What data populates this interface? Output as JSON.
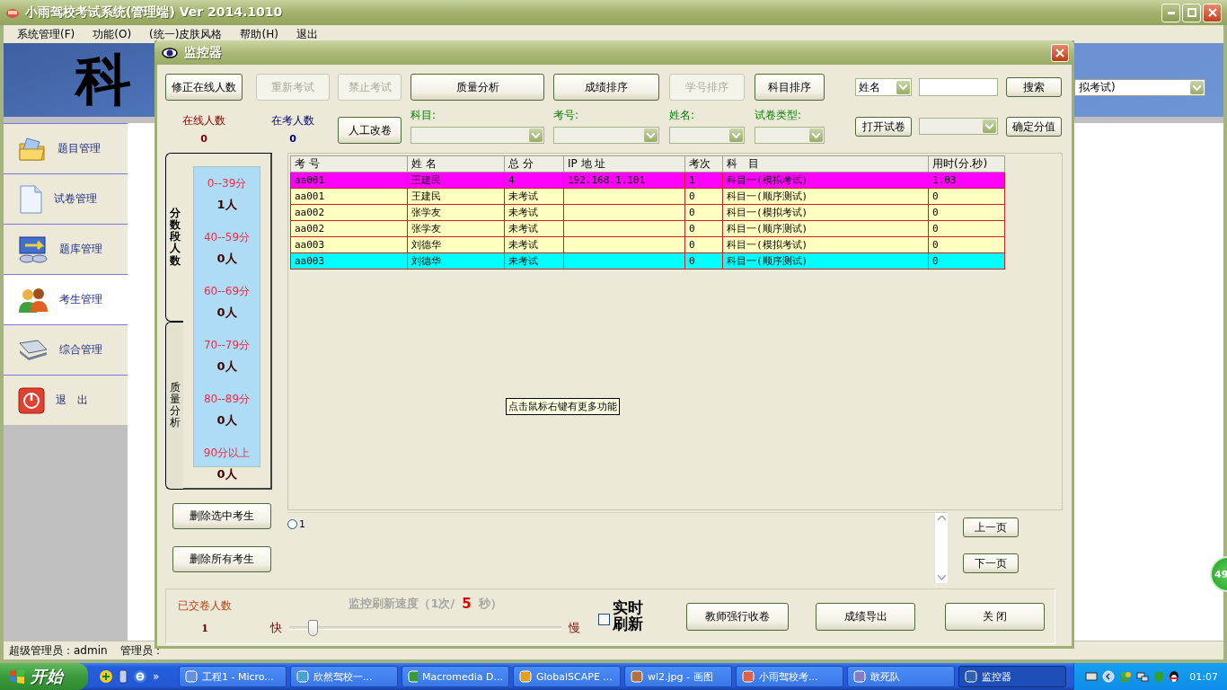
{
  "main_window": {
    "title": "小雨驾校考试系统(管理端) Ver 2014.1010",
    "menu": [
      "系统管理(F)",
      "功能(O)",
      "(统一)皮肤风格",
      "帮助(H)",
      "退出"
    ],
    "banner_text": "科",
    "banner_dropdown": "拟考试)",
    "sidebar": [
      {
        "label": "题目管理",
        "kind": "folder",
        "selected": false
      },
      {
        "label": "试卷管理",
        "kind": "document",
        "selected": false
      },
      {
        "label": "题库管理",
        "kind": "database",
        "selected": false
      },
      {
        "label": "考生管理",
        "kind": "users",
        "selected": true
      },
      {
        "label": "综合管理",
        "kind": "scanner",
        "selected": false
      },
      {
        "label": "退　出",
        "kind": "power",
        "selected": false
      }
    ],
    "status_bar": [
      "超级管理员：admin",
      "管理员："
    ]
  },
  "side_badge": "49",
  "dialog": {
    "title": "监控器",
    "toolbar": [
      {
        "label": "修正在线人数",
        "disabled": false
      },
      {
        "label": "重新考试",
        "disabled": true
      },
      {
        "label": "禁止考试",
        "disabled": true
      },
      {
        "label": "质量分析",
        "disabled": false
      },
      {
        "label": "成绩排序",
        "disabled": false
      },
      {
        "label": "学号排序",
        "disabled": true
      },
      {
        "label": "科目排序",
        "disabled": false
      }
    ],
    "search_field_select": "姓名",
    "search_button": "搜索",
    "counters": [
      {
        "label": "在线人数",
        "value": "0",
        "kind": "online"
      },
      {
        "label": "在考人数",
        "value": "0",
        "kind": "testing"
      }
    ],
    "manual_grade_button": "人工改卷",
    "filters": [
      "科目:",
      "考号:",
      "姓名:",
      "试卷类型:"
    ],
    "open_paper_button": "打开试卷",
    "confirm_score_button": "确定分值",
    "side_tabs": [
      {
        "label": "分数段人数",
        "selected": true
      },
      {
        "label": "质量分析",
        "selected": false
      }
    ],
    "score_bands": [
      {
        "range": "0--39分",
        "count": "1人"
      },
      {
        "range": "40--59分",
        "count": "0人"
      },
      {
        "range": "60--69分",
        "count": "0人"
      },
      {
        "range": "70--79分",
        "count": "0人"
      },
      {
        "range": "80--89分",
        "count": "0人"
      },
      {
        "range": "90分以上",
        "count": "0人"
      }
    ],
    "table": {
      "columns": [
        "考 号",
        "姓 名",
        "总 分",
        "IP 地 址",
        "考次",
        "科　目",
        "用时(分.秒)"
      ],
      "rows": [
        {
          "color": "#ff00ff",
          "cells": [
            "aa001",
            "王建民",
            "4",
            "192.168.1.101",
            "1",
            "科目一(模拟考试)",
            "1.03"
          ]
        },
        {
          "color": "#ffffc0",
          "cells": [
            "aa001",
            "王建民",
            "未考试",
            "",
            "0",
            "科目一(顺序测试)",
            "0"
          ]
        },
        {
          "color": "#ffffc0",
          "cells": [
            "aa002",
            "张学友",
            "未考试",
            "",
            "0",
            "科目一(模拟考试)",
            "0"
          ]
        },
        {
          "color": "#ffffc0",
          "cells": [
            "aa002",
            "张学友",
            "未考试",
            "",
            "0",
            "科目一(顺序测试)",
            "0"
          ]
        },
        {
          "color": "#ffffc0",
          "cells": [
            "aa003",
            "刘德华",
            "未考试",
            "",
            "0",
            "科目一(模拟考试)",
            "0"
          ]
        },
        {
          "color": "#00ffff",
          "cells": [
            "aa003",
            "刘德华",
            "未考试",
            "",
            "0",
            "科目一(顺序测试)",
            "0"
          ]
        }
      ]
    },
    "tooltip": "点击鼠标右键有更多功能",
    "delete_selected_button": "删除选中考生",
    "delete_all_button": "删除所有考生",
    "pages": [
      {
        "label": "1",
        "selected": false
      }
    ],
    "prev_button": "上一页",
    "next_button": "下一页",
    "submitted": {
      "label": "已交卷人数",
      "value": "1"
    },
    "refresh": {
      "prefix": "监控刷新速度（1次/",
      "seconds": "5",
      "suffix": "秒）",
      "fast": "快",
      "slow": "慢",
      "level": 0.07
    },
    "realtime": {
      "label": "实时刷新",
      "checked": false
    },
    "action_buttons": [
      "教师强行收卷",
      "成绩导出",
      "关 闭"
    ]
  },
  "taskbar": {
    "start": "开始",
    "quick_launch_more": "»",
    "items": [
      {
        "label": "工程1 - Micro...",
        "selected": false
      },
      {
        "label": "欣然驾校一...",
        "selected": false
      },
      {
        "label": "Macromedia D...",
        "selected": false
      },
      {
        "label": "GlobalSCAPE ...",
        "selected": false
      },
      {
        "label": "wl2.jpg - 画图",
        "selected": false
      },
      {
        "label": "小雨驾校考...",
        "selected": false
      },
      {
        "label": "敢死队",
        "selected": false
      },
      {
        "label": "监控器",
        "selected": true
      }
    ],
    "clock": "01:07"
  }
}
